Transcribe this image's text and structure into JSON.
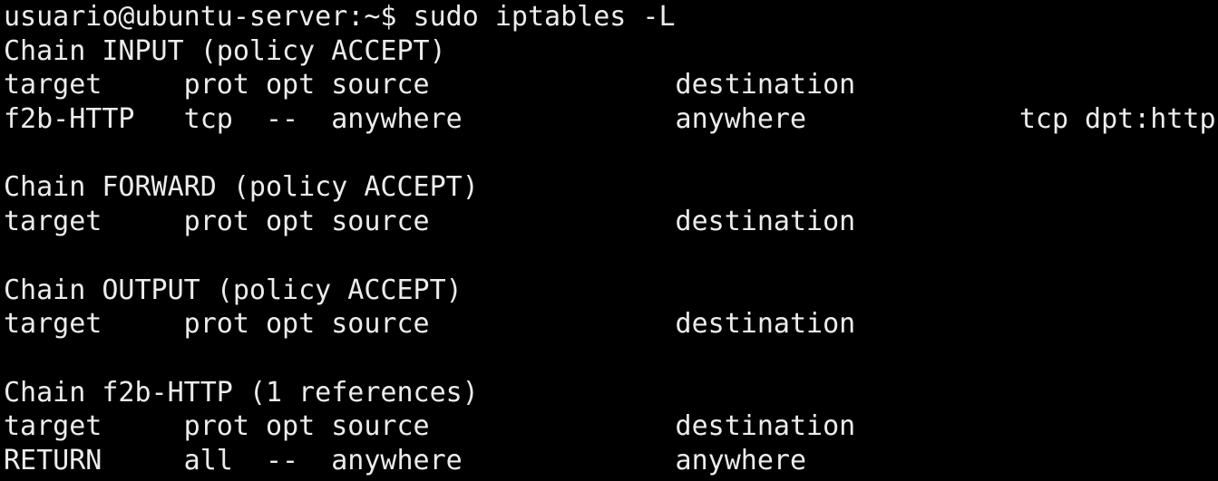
{
  "terminal": {
    "prompt": "usuario@ubuntu-server:~$ ",
    "command": "sudo iptables -L",
    "lines": [
      "Chain INPUT (policy ACCEPT)",
      "target     prot opt source               destination",
      "f2b-HTTP   tcp  --  anywhere             anywhere             tcp dpt:http",
      "",
      "Chain FORWARD (policy ACCEPT)",
      "target     prot opt source               destination",
      "",
      "Chain OUTPUT (policy ACCEPT)",
      "target     prot opt source               destination",
      "",
      "Chain f2b-HTTP (1 references)",
      "target     prot opt source               destination",
      "RETURN     all  --  anywhere             anywhere"
    ]
  }
}
